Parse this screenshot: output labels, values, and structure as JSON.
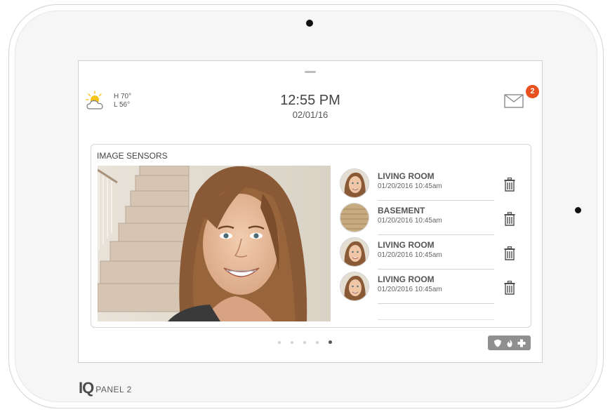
{
  "weather": {
    "high": "H 70°",
    "low": "L 56°",
    "icon": "partly-cloudy-icon"
  },
  "clock": {
    "time": "12:55 PM",
    "date": "02/01/16"
  },
  "notifications": {
    "count": "2",
    "icon": "mail-icon"
  },
  "image_sensors": {
    "title": "IMAGE SENSORS",
    "events": [
      {
        "room": "LIVING ROOM",
        "timestamp": "01/20/2016 10:45am",
        "thumb": "face"
      },
      {
        "room": "BASEMENT",
        "timestamp": "01/20/2016 10:45am",
        "thumb": "basement"
      },
      {
        "room": "LIVING ROOM",
        "timestamp": "01/20/2016 10:45am",
        "thumb": "face"
      },
      {
        "room": "LIVING ROOM",
        "timestamp": "01/20/2016 10:45am",
        "thumb": "face"
      }
    ]
  },
  "pager": {
    "pages": 5,
    "active_index": 4
  },
  "quick_actions": {
    "icons": [
      "shield-icon",
      "fire-icon",
      "medical-cross-icon"
    ]
  },
  "brand": {
    "logo": "IQ",
    "name": "PANEL 2"
  },
  "colors": {
    "badge": "#e8511d",
    "quick_bar": "#8f8f8f",
    "sun": "#f5c319"
  }
}
